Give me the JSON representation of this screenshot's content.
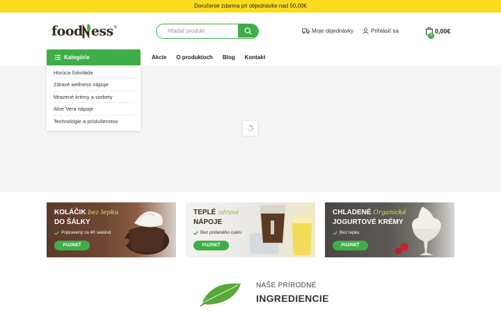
{
  "topbar": {
    "text": "Doručenie zdarma pri objednávke nad 50,00€"
  },
  "header": {
    "logo_left": "food",
    "logo_right": "ess",
    "search_placeholder": "Hľadať produkt",
    "orders_label": "Moje objednávky",
    "login_label": "Prihlásiť sa",
    "cart_total": "0,00€",
    "cart_count": "0"
  },
  "nav": {
    "categories_label": "Kategórie",
    "links": [
      "Akcie",
      "O produktoch",
      "Blog",
      "Kontakt"
    ]
  },
  "categories": [
    "Horúca čokoláda",
    "Zdravé wellness nápoje",
    "Mrazené krémy a sorbety",
    "Aloe Vera nápoje",
    "Technológie a príslušenstvo"
  ],
  "banners": [
    {
      "title_1": "KOLÁČIK",
      "script": "bez lepku",
      "title_2": "DO ŠÁLKY",
      "check": "Pripravený za 40 sekúnd",
      "button": "POZRIEŤ"
    },
    {
      "title_1": "TEPLÉ",
      "script": "zdravé",
      "title_2": "NÁPOJE",
      "check": "Bez pridaného cukru",
      "button": "POZRIEŤ"
    },
    {
      "title_1": "CHLADENÉ",
      "script": "Organické",
      "title_2": "JOGURTOVÉ KRÉMY",
      "check": "Bez lepku",
      "button": "POZRIEŤ"
    }
  ],
  "ingredients": {
    "subtitle": "NAŠE PRÍRODNÉ",
    "title": "INGREDIENCIE"
  },
  "colors": {
    "accent": "#3fae49",
    "topbar": "#fbdb1c"
  }
}
